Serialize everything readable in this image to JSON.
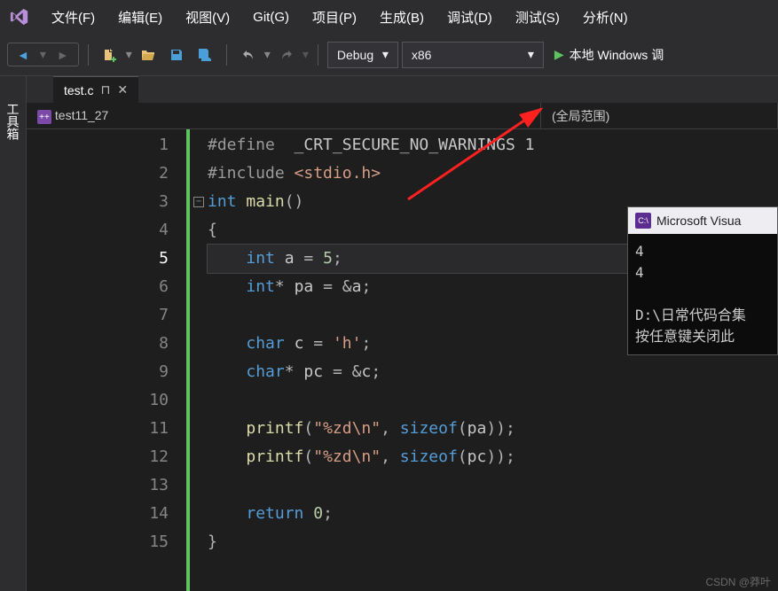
{
  "menu": {
    "items": [
      "文件(F)",
      "编辑(E)",
      "视图(V)",
      "Git(G)",
      "项目(P)",
      "生成(B)",
      "调试(D)",
      "测试(S)",
      "分析(N)"
    ]
  },
  "toolbar": {
    "config": "Debug",
    "platform": "x86",
    "run_label": "本地 Windows 调"
  },
  "sidebar": {
    "toolbox": "工具箱"
  },
  "tab": {
    "filename": "test.c"
  },
  "navbar": {
    "scope1": "test11_27",
    "scope2": "(全局范围)"
  },
  "code": {
    "lines": [
      {
        "n": 1,
        "html": "<span class='pre'>#define</span>  <span class='txt'>_CRT_SECURE_NO_WARNINGS 1</span>"
      },
      {
        "n": 2,
        "html": "<span class='pre'>#include</span> <span class='inc'>&lt;stdio.h&gt;</span>"
      },
      {
        "n": 3,
        "html": "<span class='kw'>int</span> <span class='fn'>main</span><span class='op'>()</span>"
      },
      {
        "n": 4,
        "html": "<span class='op'>{</span>"
      },
      {
        "n": 5,
        "current": true,
        "html": "    <span class='kw'>int</span> <span class='txt'>a</span> <span class='op'>=</span> <span class='num'>5</span><span class='op'>;</span>"
      },
      {
        "n": 6,
        "html": "    <span class='kw'>int</span><span class='op'>*</span> <span class='txt'>pa</span> <span class='op'>=</span> <span class='op'>&amp;</span><span class='txt'>a</span><span class='op'>;</span>"
      },
      {
        "n": 7,
        "html": ""
      },
      {
        "n": 8,
        "html": "    <span class='kw'>char</span> <span class='txt'>c</span> <span class='op'>=</span> <span class='str'>'h'</span><span class='op'>;</span>"
      },
      {
        "n": 9,
        "html": "    <span class='kw'>char</span><span class='op'>*</span> <span class='txt'>pc</span> <span class='op'>=</span> <span class='op'>&amp;</span><span class='txt'>c</span><span class='op'>;</span>"
      },
      {
        "n": 10,
        "html": ""
      },
      {
        "n": 11,
        "html": "    <span class='fn'>printf</span><span class='op'>(</span><span class='str'>\"%zd\\n\"</span><span class='op'>,</span> <span class='kw'>sizeof</span><span class='op'>(</span><span class='txt'>pa</span><span class='op'>));</span>"
      },
      {
        "n": 12,
        "html": "    <span class='fn'>printf</span><span class='op'>(</span><span class='str'>\"%zd\\n\"</span><span class='op'>,</span> <span class='kw'>sizeof</span><span class='op'>(</span><span class='txt'>pc</span><span class='op'>));</span>"
      },
      {
        "n": 13,
        "html": ""
      },
      {
        "n": 14,
        "html": "    <span class='kw'>return</span> <span class='num'>0</span><span class='op'>;</span>"
      },
      {
        "n": 15,
        "html": "<span class='op'>}</span>"
      }
    ]
  },
  "console": {
    "title": "Microsoft Visua",
    "out1": "4",
    "out2": "4",
    "path": "D:\\日常代码合集",
    "prompt": "按任意键关闭此"
  },
  "watermark": "CSDN @莽叶"
}
